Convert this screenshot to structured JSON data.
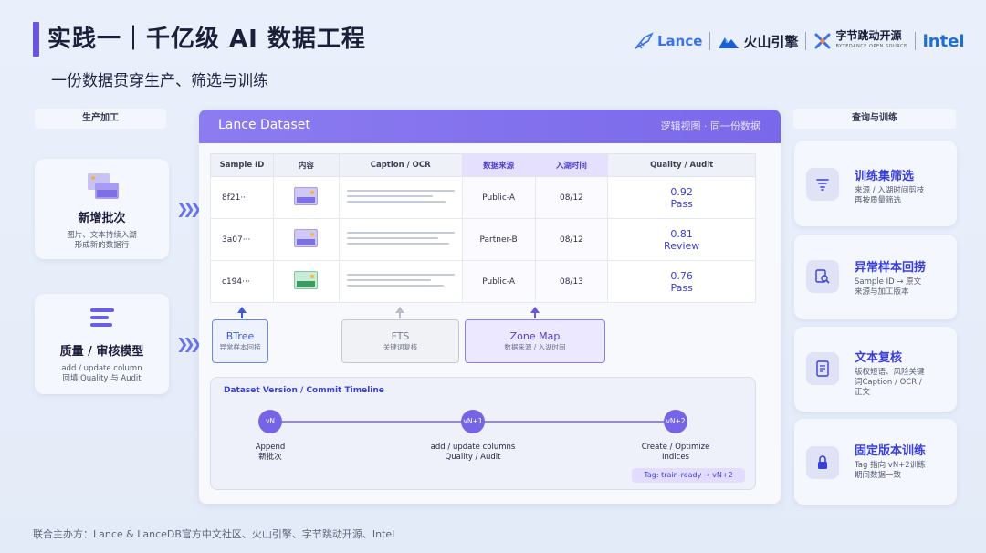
{
  "header": {
    "title": "实践一｜千亿级 AI 数据工程",
    "subtitle": "一份数据贯穿生产、筛选与训练",
    "logos": {
      "lance": "Lance",
      "volcengine": "火山引擎",
      "bytedance": "字节跳动开源",
      "bytedance_sub": "BYTEDANCE OPEN SOURCE",
      "intel": "intel"
    }
  },
  "left": {
    "label": "生产加工",
    "cards": [
      {
        "title": "新增批次",
        "desc1": "图片、文本持续入湖",
        "desc2": "形成新的数据行"
      },
      {
        "title": "质量 / 审核模型",
        "desc1": "add / update column",
        "desc2": "回填 Quality 与 Audit"
      }
    ]
  },
  "panel": {
    "title": "Lance Dataset",
    "note": "逻辑视图 · 同一份数据",
    "columns": [
      "Sample ID",
      "内容",
      "Caption / OCR",
      "数据来源",
      "入湖时间",
      "Quality / Audit"
    ],
    "rows": [
      {
        "id": "8f21···",
        "thumb": "purple",
        "source": "Public-A",
        "time": "08/12",
        "score": "0.92",
        "status": "Pass"
      },
      {
        "id": "3a07···",
        "thumb": "purple",
        "source": "Partner-B",
        "time": "08/12",
        "score": "0.81",
        "status": "Review"
      },
      {
        "id": "c194···",
        "thumb": "green",
        "source": "Public-A",
        "time": "08/13",
        "score": "0.76",
        "status": "Pass"
      }
    ],
    "indices": [
      {
        "name": "BTree",
        "desc": "异常样本回捞"
      },
      {
        "name": "FTS",
        "desc": "关键词复核"
      },
      {
        "name": "Zone Map",
        "desc": "数据来源 / 入湖时间"
      }
    ],
    "timeline": {
      "title": "Dataset Version / Commit Timeline",
      "nodes": [
        {
          "label": "vN",
          "line1": "Append",
          "line2": "新批次"
        },
        {
          "label": "vN+1",
          "line1": "add / update columns",
          "line2": "Quality / Audit"
        },
        {
          "label": "vN+2",
          "line1": "Create / Optimize",
          "line2": "Indices"
        }
      ],
      "tag": "Tag: train-ready → vN+2"
    }
  },
  "right": {
    "label": "查询与训练",
    "cards": [
      {
        "title": "训练集筛选",
        "icon": "filter-icon",
        "desc1": "来源 / 入湖时间剪枝",
        "desc2": "再按质量筛选",
        "desc3": ""
      },
      {
        "title": "异常样本回捞",
        "icon": "search-doc-icon",
        "desc1": "Sample ID → 原文",
        "desc2": "来源与加工版本",
        "desc3": ""
      },
      {
        "title": "文本复核",
        "icon": "document-icon",
        "desc1": "版权短语、风险关键",
        "desc2": "词Caption / OCR /",
        "desc3": "正文"
      },
      {
        "title": "固定版本训练",
        "icon": "lock-icon",
        "desc1": "Tag 指向 vN+2训练",
        "desc2": "期间数据一致",
        "desc3": ""
      }
    ]
  },
  "footer": "联合主办方：Lance & LanceDB官方中文社区、火山引擎、字节跳动开源、Intel",
  "colors": {
    "accent": "#6a55e0",
    "link": "#3a3fd8",
    "panel_head": "#8c7cf0"
  }
}
